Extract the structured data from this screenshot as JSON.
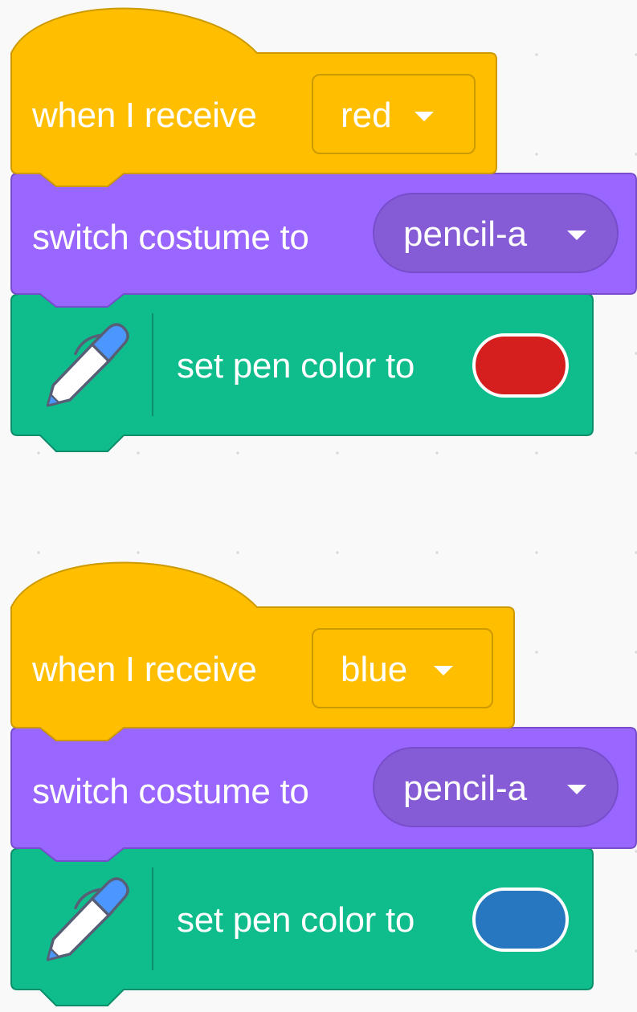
{
  "scripts": [
    {
      "hat": {
        "prefix": "when I receive",
        "message": "red"
      },
      "costume": {
        "prefix": "switch costume to",
        "value": "pencil-a"
      },
      "pen": {
        "prefix": "set pen color to",
        "color": "#d51f1f"
      }
    },
    {
      "hat": {
        "prefix": "when I receive",
        "message": "blue"
      },
      "costume": {
        "prefix": "switch costume to",
        "value": "pencil-a"
      },
      "pen": {
        "prefix": "set pen color to",
        "color": "#2677bf"
      }
    }
  ],
  "colors": {
    "events": "#ffbf00",
    "events_border": "#cc9900",
    "looks": "#9966ff",
    "looks_border": "#774dcb",
    "pen": "#0fbd8c",
    "pen_border": "#0b8e69",
    "workspace": "#f9f9f9"
  },
  "icons": {
    "pen_extension": "pen-icon",
    "dropdown": "dropdown-arrow-icon"
  }
}
